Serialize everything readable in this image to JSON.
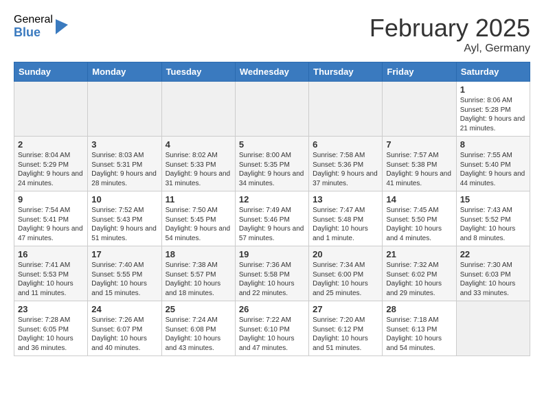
{
  "logo": {
    "general": "General",
    "blue": "Blue"
  },
  "header": {
    "title": "February 2025",
    "subtitle": "Ayl, Germany"
  },
  "days_of_week": [
    "Sunday",
    "Monday",
    "Tuesday",
    "Wednesday",
    "Thursday",
    "Friday",
    "Saturday"
  ],
  "weeks": [
    {
      "shaded": false,
      "days": [
        {
          "num": "",
          "info": ""
        },
        {
          "num": "",
          "info": ""
        },
        {
          "num": "",
          "info": ""
        },
        {
          "num": "",
          "info": ""
        },
        {
          "num": "",
          "info": ""
        },
        {
          "num": "",
          "info": ""
        },
        {
          "num": "1",
          "info": "Sunrise: 8:06 AM\nSunset: 5:28 PM\nDaylight: 9 hours and 21 minutes."
        }
      ]
    },
    {
      "shaded": true,
      "days": [
        {
          "num": "2",
          "info": "Sunrise: 8:04 AM\nSunset: 5:29 PM\nDaylight: 9 hours and 24 minutes."
        },
        {
          "num": "3",
          "info": "Sunrise: 8:03 AM\nSunset: 5:31 PM\nDaylight: 9 hours and 28 minutes."
        },
        {
          "num": "4",
          "info": "Sunrise: 8:02 AM\nSunset: 5:33 PM\nDaylight: 9 hours and 31 minutes."
        },
        {
          "num": "5",
          "info": "Sunrise: 8:00 AM\nSunset: 5:35 PM\nDaylight: 9 hours and 34 minutes."
        },
        {
          "num": "6",
          "info": "Sunrise: 7:58 AM\nSunset: 5:36 PM\nDaylight: 9 hours and 37 minutes."
        },
        {
          "num": "7",
          "info": "Sunrise: 7:57 AM\nSunset: 5:38 PM\nDaylight: 9 hours and 41 minutes."
        },
        {
          "num": "8",
          "info": "Sunrise: 7:55 AM\nSunset: 5:40 PM\nDaylight: 9 hours and 44 minutes."
        }
      ]
    },
    {
      "shaded": false,
      "days": [
        {
          "num": "9",
          "info": "Sunrise: 7:54 AM\nSunset: 5:41 PM\nDaylight: 9 hours and 47 minutes."
        },
        {
          "num": "10",
          "info": "Sunrise: 7:52 AM\nSunset: 5:43 PM\nDaylight: 9 hours and 51 minutes."
        },
        {
          "num": "11",
          "info": "Sunrise: 7:50 AM\nSunset: 5:45 PM\nDaylight: 9 hours and 54 minutes."
        },
        {
          "num": "12",
          "info": "Sunrise: 7:49 AM\nSunset: 5:46 PM\nDaylight: 9 hours and 57 minutes."
        },
        {
          "num": "13",
          "info": "Sunrise: 7:47 AM\nSunset: 5:48 PM\nDaylight: 10 hours and 1 minute."
        },
        {
          "num": "14",
          "info": "Sunrise: 7:45 AM\nSunset: 5:50 PM\nDaylight: 10 hours and 4 minutes."
        },
        {
          "num": "15",
          "info": "Sunrise: 7:43 AM\nSunset: 5:52 PM\nDaylight: 10 hours and 8 minutes."
        }
      ]
    },
    {
      "shaded": true,
      "days": [
        {
          "num": "16",
          "info": "Sunrise: 7:41 AM\nSunset: 5:53 PM\nDaylight: 10 hours and 11 minutes."
        },
        {
          "num": "17",
          "info": "Sunrise: 7:40 AM\nSunset: 5:55 PM\nDaylight: 10 hours and 15 minutes."
        },
        {
          "num": "18",
          "info": "Sunrise: 7:38 AM\nSunset: 5:57 PM\nDaylight: 10 hours and 18 minutes."
        },
        {
          "num": "19",
          "info": "Sunrise: 7:36 AM\nSunset: 5:58 PM\nDaylight: 10 hours and 22 minutes."
        },
        {
          "num": "20",
          "info": "Sunrise: 7:34 AM\nSunset: 6:00 PM\nDaylight: 10 hours and 25 minutes."
        },
        {
          "num": "21",
          "info": "Sunrise: 7:32 AM\nSunset: 6:02 PM\nDaylight: 10 hours and 29 minutes."
        },
        {
          "num": "22",
          "info": "Sunrise: 7:30 AM\nSunset: 6:03 PM\nDaylight: 10 hours and 33 minutes."
        }
      ]
    },
    {
      "shaded": false,
      "days": [
        {
          "num": "23",
          "info": "Sunrise: 7:28 AM\nSunset: 6:05 PM\nDaylight: 10 hours and 36 minutes."
        },
        {
          "num": "24",
          "info": "Sunrise: 7:26 AM\nSunset: 6:07 PM\nDaylight: 10 hours and 40 minutes."
        },
        {
          "num": "25",
          "info": "Sunrise: 7:24 AM\nSunset: 6:08 PM\nDaylight: 10 hours and 43 minutes."
        },
        {
          "num": "26",
          "info": "Sunrise: 7:22 AM\nSunset: 6:10 PM\nDaylight: 10 hours and 47 minutes."
        },
        {
          "num": "27",
          "info": "Sunrise: 7:20 AM\nSunset: 6:12 PM\nDaylight: 10 hours and 51 minutes."
        },
        {
          "num": "28",
          "info": "Sunrise: 7:18 AM\nSunset: 6:13 PM\nDaylight: 10 hours and 54 minutes."
        },
        {
          "num": "",
          "info": ""
        }
      ]
    }
  ]
}
